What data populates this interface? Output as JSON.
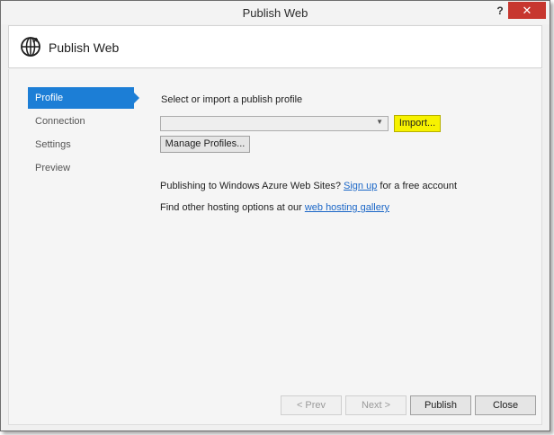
{
  "window": {
    "title": "Publish Web",
    "help_glyph": "?",
    "close_glyph": "✕"
  },
  "header": {
    "icon": "globe-publish-icon",
    "title": "Publish Web"
  },
  "nav": {
    "items": [
      {
        "label": "Profile",
        "active": true
      },
      {
        "label": "Connection",
        "active": false
      },
      {
        "label": "Settings",
        "active": false
      },
      {
        "label": "Preview",
        "active": false
      }
    ]
  },
  "profile": {
    "prompt": "Select or import a publish profile",
    "profile_select_value": "",
    "import_label": "Import...",
    "manage_label": "Manage Profiles...",
    "azure_text_before": "Publishing to Windows Azure Web Sites?",
    "azure_link": "Sign up",
    "azure_text_after": "for a free account",
    "hosting_text_before": "Find other hosting options at our",
    "hosting_link": "web hosting gallery"
  },
  "footer": {
    "prev_label": "< Prev",
    "next_label": "Next >",
    "publish_label": "Publish",
    "close_label": "Close"
  },
  "colors": {
    "accent": "#1c7ed6",
    "highlight": "#f7f200",
    "close": "#c7372f",
    "link": "#1a66c7"
  }
}
